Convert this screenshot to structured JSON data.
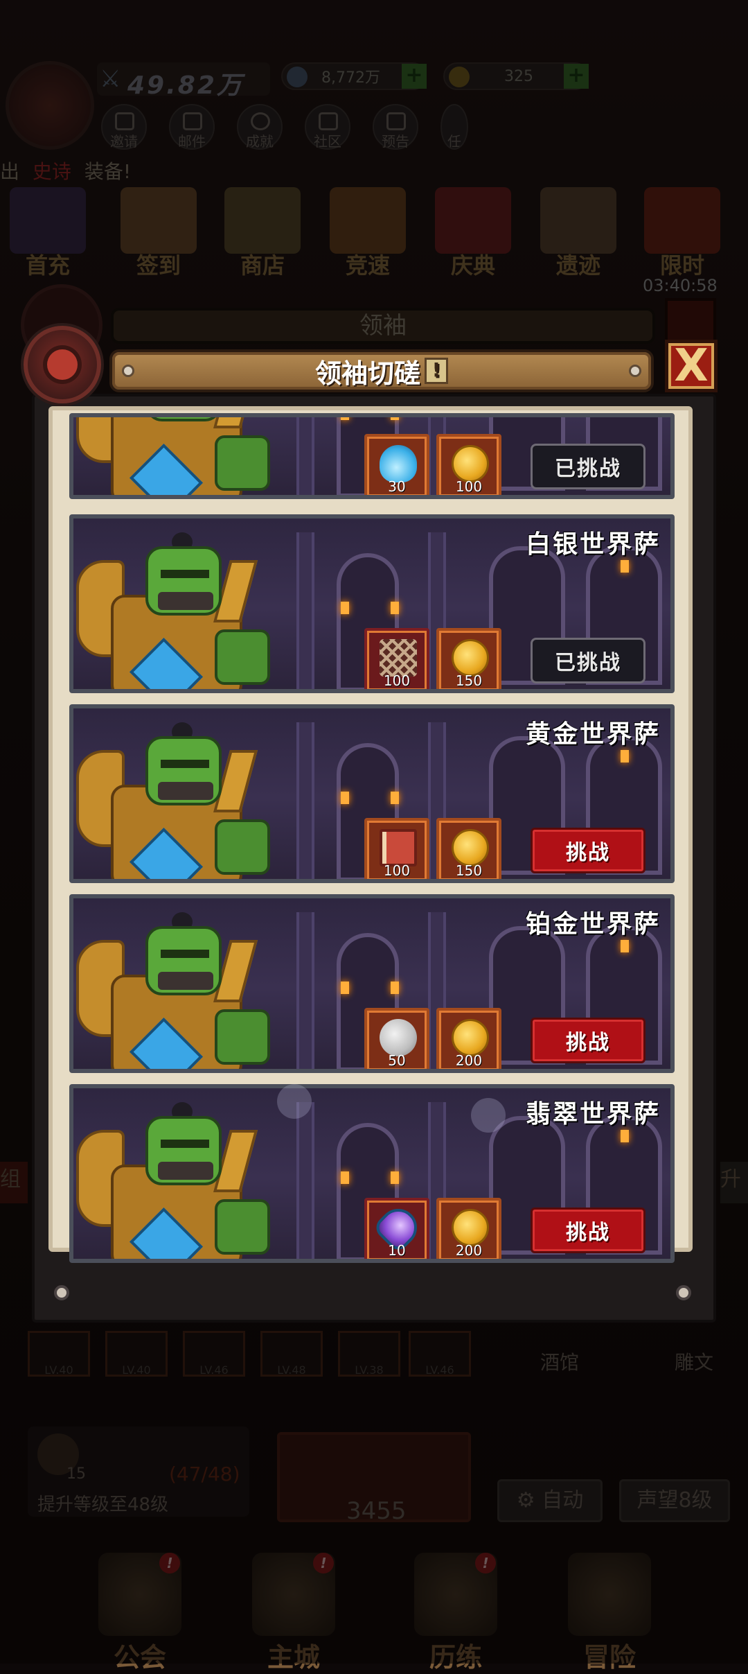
{
  "hud": {
    "power": "49.82万",
    "currency1": "8,772万",
    "currency2": "325",
    "plus": "+"
  },
  "top_icons": [
    "邀请",
    "邮件",
    "成就",
    "社区",
    "预告",
    "任"
  ],
  "ticker": {
    "prefix": "出",
    "highlight": "史诗",
    "suffix": "装备!"
  },
  "features": [
    {
      "label": "首充"
    },
    {
      "label": "签到"
    },
    {
      "label": "商店"
    },
    {
      "label": "竞速"
    },
    {
      "label": "庆典"
    },
    {
      "label": "遗迹"
    },
    {
      "label": "限时"
    }
  ],
  "timer": "03:40:58",
  "back_modal_title": "领袖",
  "modal": {
    "title": "领袖切磋",
    "hint_icon": "!",
    "close_icon": "X"
  },
  "cards": [
    {
      "name": "",
      "items": [
        {
          "icon": "potion",
          "qty": "30"
        },
        {
          "icon": "gold",
          "qty": "100"
        }
      ],
      "button": "已挑战",
      "state": "done"
    },
    {
      "name": "白银世界萨",
      "items": [
        {
          "icon": "net",
          "qty": "100"
        },
        {
          "icon": "gold",
          "qty": "150"
        }
      ],
      "button": "已挑战",
      "state": "done"
    },
    {
      "name": "黄金世界萨",
      "items": [
        {
          "icon": "book",
          "qty": "100"
        },
        {
          "icon": "gold",
          "qty": "150"
        }
      ],
      "button": "挑战",
      "state": "go"
    },
    {
      "name": "铂金世界萨",
      "items": [
        {
          "icon": "silver",
          "qty": "50"
        },
        {
          "icon": "gold",
          "qty": "200"
        }
      ],
      "button": "挑战",
      "state": "go"
    },
    {
      "name": "翡翠世界萨",
      "items": [
        {
          "icon": "crystal",
          "qty": "10"
        },
        {
          "icon": "gold",
          "qty": "200"
        }
      ],
      "button": "挑战",
      "state": "go"
    }
  ],
  "bottom_area": {
    "side_left": "组",
    "side_right": "升",
    "levels": [
      "LV.40",
      "LV.40",
      "LV.46",
      "LV.48",
      "LV.38",
      "LV.46"
    ],
    "tavern": "酒馆",
    "statue": "雕文",
    "quest_count": "15",
    "quest_progress": "(47/48)",
    "quest_text": "提升等级至48级",
    "boss_power": "3455",
    "auto_label": "自动",
    "fame_label": "声望8级"
  },
  "nav": [
    {
      "label": "公会",
      "badge": "!"
    },
    {
      "label": "主城",
      "badge": "!"
    },
    {
      "label": "历练",
      "badge": "!"
    },
    {
      "label": "冒险",
      "badge": ""
    }
  ]
}
